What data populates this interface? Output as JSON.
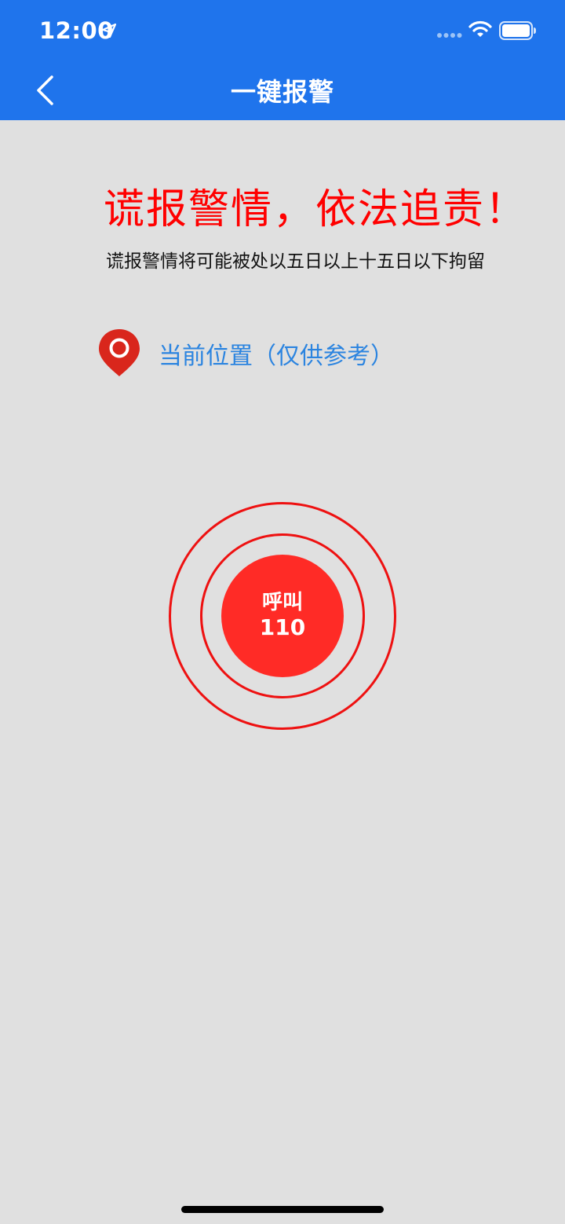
{
  "status_bar": {
    "time": "12:00"
  },
  "nav": {
    "title": "一键报警"
  },
  "warning": {
    "title": "谎报警情，依法追责！",
    "subtitle": "谎报警情将可能被处以五日以上十五日以下拘留"
  },
  "location": {
    "label": "当前位置（仅供参考）"
  },
  "call": {
    "label": "呼叫",
    "number": "110"
  },
  "colors": {
    "header": "#1f74ec",
    "background": "#e0e0e0",
    "warning": "#ff0000",
    "call_button": "#ff2b26",
    "link": "#2b84e0",
    "pin": "#d9261c"
  },
  "icons": {
    "back": "chevron-left-icon",
    "location_arrow": "location-arrow-icon",
    "signal": "signal-icon",
    "wifi": "wifi-icon",
    "battery": "battery-icon",
    "pin": "map-pin-icon"
  }
}
